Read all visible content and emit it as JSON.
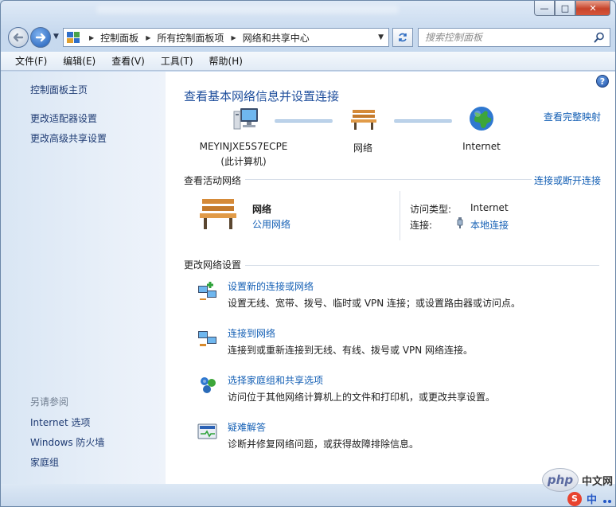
{
  "window": {
    "buttons": {
      "minimize": "—",
      "maximize": "□",
      "close": "✕"
    }
  },
  "address": {
    "breadcrumbs": [
      "控制面板",
      "所有控制面板项",
      "网络和共享中心"
    ],
    "search_placeholder": "搜索控制面板"
  },
  "menu": {
    "items": [
      "文件(F)",
      "编辑(E)",
      "查看(V)",
      "工具(T)",
      "帮助(H)"
    ]
  },
  "sidebar": {
    "links": [
      "控制面板主页",
      "更改适配器设置",
      "更改高级共享设置"
    ],
    "see_also_title": "另请参阅",
    "see_also": [
      "Internet 选项",
      "Windows 防火墙",
      "家庭组"
    ]
  },
  "main": {
    "title": "查看基本网络信息并设置连接",
    "view_full_map": "查看完整映射",
    "map": {
      "computer_name": "MEYINJXE5S7ECPE",
      "computer_sub": "(此计算机)",
      "network": "网络",
      "internet": "Internet"
    },
    "active_networks": {
      "heading": "查看活动网络",
      "connect_link": "连接或断开连接",
      "network_name": "网络",
      "network_type": "公用网络",
      "access_type_label": "访问类型:",
      "access_type_value": "Internet",
      "connections_label": "连接:",
      "connections_value": "本地连接"
    },
    "change_settings": {
      "heading": "更改网络设置",
      "tasks": [
        {
          "title": "设置新的连接或网络",
          "desc": "设置无线、宽带、拨号、临时或 VPN 连接；或设置路由器或访问点。"
        },
        {
          "title": "连接到网络",
          "desc": "连接到或重新连接到无线、有线、拨号或 VPN 网络连接。"
        },
        {
          "title": "选择家庭组和共享选项",
          "desc": "访问位于其他网络计算机上的文件和打印机，或更改共享设置。"
        },
        {
          "title": "疑难解答",
          "desc": "诊断并修复网络问题，或获得故障排除信息。"
        }
      ]
    }
  },
  "overlay": {
    "watermark_logo": "php",
    "watermark_text": "中文网",
    "ime_s": "S",
    "ime_lang": "中"
  },
  "colors": {
    "link": "#1560b5",
    "title": "#1e4e9c",
    "sidebar_link": "#1e3b73"
  }
}
